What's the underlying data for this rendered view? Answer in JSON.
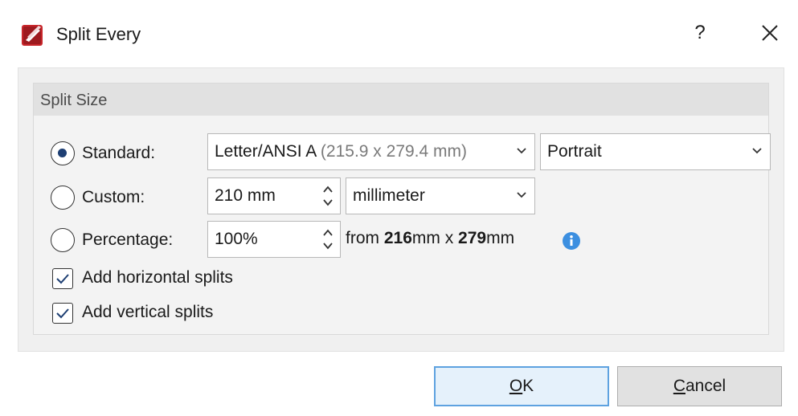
{
  "window": {
    "title": "Split Every",
    "help_label": "?",
    "close_icon": "close-icon"
  },
  "group": {
    "title": "Split Size"
  },
  "standard": {
    "label": "Standard:",
    "selected": true,
    "size_value": "Letter/ANSI A",
    "size_hint": "(215.9 x 279.4 mm)",
    "orientation_value": "Portrait"
  },
  "custom": {
    "label": "Custom:",
    "selected": false,
    "width_value": "210 mm",
    "unit_value": "millimeter"
  },
  "percentage": {
    "label": "Percentage:",
    "selected": false,
    "value": "100%",
    "from_prefix": "from ",
    "from_width": "216",
    "unit1": "mm x ",
    "from_height": "279",
    "unit2": "mm"
  },
  "options": {
    "horizontal_label": "Add horizontal splits",
    "horizontal_checked": true,
    "vertical_label": "Add vertical splits",
    "vertical_checked": true
  },
  "buttons": {
    "ok_label": "OK",
    "ok_mnemonic": "O",
    "ok_rest": "K",
    "cancel_mnemonic": "C",
    "cancel_rest": "ancel"
  },
  "colors": {
    "accent": "#5ea2e0",
    "radio_dot": "#1e3f73",
    "info": "#3c8fe0",
    "app_icon_red": "#c8262b"
  }
}
